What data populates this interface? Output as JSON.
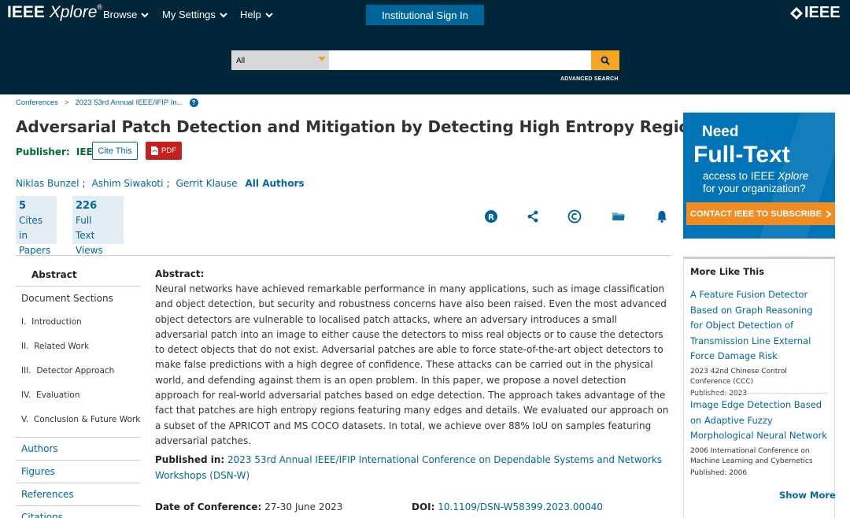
{
  "header": {
    "logo_main": "IEEE",
    "logo_italic": "Xplore",
    "logo_reg": "®",
    "nav": [
      {
        "label": "Browse"
      },
      {
        "label": "My Settings"
      },
      {
        "label": "Help"
      }
    ],
    "signin_label": "Institutional Sign In",
    "brand": "IEEE",
    "colors": {
      "header_bg": "#002639",
      "signin_bg": "#006699",
      "search_btn": "#f5a623"
    }
  },
  "search": {
    "scope_value": "All",
    "query_value": "",
    "placeholder": "",
    "advanced_label": "ADVANCED SEARCH"
  },
  "breadcrumb": {
    "items": [
      "Conferences",
      "2023 53rd Annual IEEE/IFIP In..."
    ],
    "separator": ">",
    "help": "?"
  },
  "paper": {
    "title": "Adversarial Patch Detection and Mitigation by Detecting High Entropy Regions",
    "publisher_label": "Publisher:",
    "publisher_value": "IEEE",
    "cite_label": "Cite This",
    "pdf_label": "PDF",
    "authors": [
      "Niklas Bunzel",
      "Ashim Siwakoti",
      "Gerrit Klause"
    ],
    "author_sep": ";",
    "all_authors_label": "All Authors",
    "metrics": [
      {
        "value": "5",
        "line1": "Cites in",
        "line2": "Papers"
      },
      {
        "value": "226",
        "line1": "Full",
        "line2": "Text Views"
      }
    ],
    "tool_icons": [
      "rights-icon",
      "share-icon",
      "copyright-icon",
      "folder-icon",
      "alert-bell-icon"
    ]
  },
  "sidebar": {
    "abstract_label": "Abstract",
    "doc_sections_label": "Document Sections",
    "sections": [
      {
        "num": "I.",
        "label": "Introduction"
      },
      {
        "num": "II.",
        "label": "Related Work"
      },
      {
        "num": "III.",
        "label": "Detector Approach"
      },
      {
        "num": "IV.",
        "label": "Evaluation"
      },
      {
        "num": "V.",
        "label": "Conclusion & Future Work"
      }
    ],
    "links": [
      "Authors",
      "Figures",
      "References",
      "Citations"
    ]
  },
  "abstract": {
    "label": "Abstract:",
    "text": "Neural networks have achieved remarkable performance in many applications, such as image classification and object detection, but security and robustness concerns have also been raised. Even the most advanced object detectors are vulnerable to localised patch attacks, where an adversary introduces a small adversarial patch into an image to either cause the detectors to miss real objects or to cause the detectors to detect objects that do not exist. Adversarial patches are able to force state-of-the-art object detectors to make false predictions with a high degree of confidence. These attacks can be carried out in the physical world, and defending against them is an open problem. In this paper, we propose a novel detection approach for real-world adversarial patches based on edge detection. The approach takes advantage of the fact that patches are high entropy regions featuring many edges and details. We evaluated our approach on a subset of the APRICOT and MS COCO datasets. In total, we achieve over 88% IoU on samples featuring adversarial patches."
  },
  "details": {
    "published_in_label": "Published in:",
    "published_in_value": "2023 53rd Annual IEEE/IFIP International Conference on Dependable Systems and Networks Workshops (DSN-W)",
    "date_label": "Date of Conference:",
    "date_value": "27-30 June 2023",
    "doi_label": "DOI:",
    "doi_value": "10.1109/DSN-W58399.2023.00040"
  },
  "ad": {
    "line1": "Need",
    "line2": "Full-Text",
    "line3a": "access to IEEE ",
    "line3b": "Xplore",
    "line4": "for your organization?",
    "cta": "CONTACT IEEE TO SUBSCRIBE",
    "colors": {
      "bg": "#0074b7",
      "cta": "#f28b20"
    }
  },
  "more_like_this": {
    "heading": "More Like This",
    "items": [
      {
        "title": "A Feature Fusion Detector Based on Graph Reasoning for Object Detection of Transmission Line External Force Damage Risk",
        "source": "2023 42nd Chinese Control Conference (CCC)",
        "published": "Published: 2023"
      },
      {
        "title": "Image Edge Detection Based on Adaptive Fuzzy Morphological Neural Network",
        "source": "2006 International Conference on Machine Learning and Cybernetics",
        "published": "Published: 2006"
      }
    ],
    "show_more": "Show More"
  }
}
